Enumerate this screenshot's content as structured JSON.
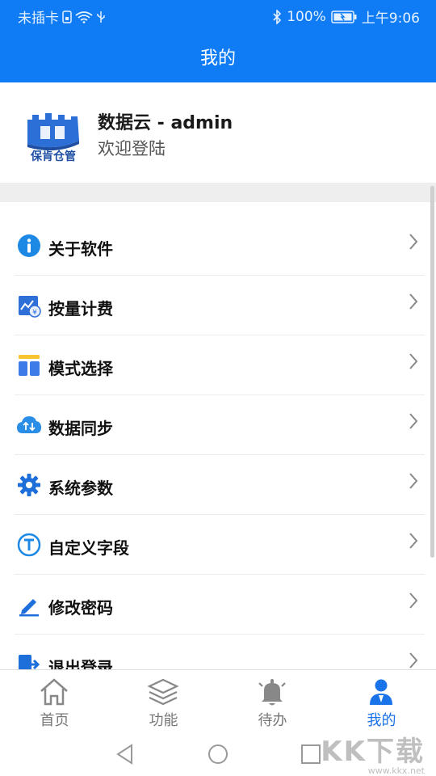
{
  "status_bar": {
    "carrier": "未插卡",
    "battery": "100%",
    "time": "上午9:06"
  },
  "header": {
    "title": "我的"
  },
  "profile": {
    "logo_text": "保肯仓管",
    "name": "数据云 - admin",
    "welcome": "欢迎登陆"
  },
  "menu": {
    "items": [
      {
        "label": "关于软件",
        "icon": "info-icon"
      },
      {
        "label": "按量计费",
        "icon": "billing-icon"
      },
      {
        "label": "模式选择",
        "icon": "mode-layout-icon"
      },
      {
        "label": "数据同步",
        "icon": "cloud-sync-icon"
      },
      {
        "label": "系统参数",
        "icon": "gear-icon"
      },
      {
        "label": "自定义字段",
        "icon": "text-t-icon"
      },
      {
        "label": "修改密码",
        "icon": "pencil-icon"
      },
      {
        "label": "退出登录",
        "icon": "logout-icon"
      }
    ]
  },
  "tabs": [
    {
      "label": "首页",
      "icon": "home-icon"
    },
    {
      "label": "功能",
      "icon": "layers-icon"
    },
    {
      "label": "待办",
      "icon": "bell-icon"
    },
    {
      "label": "我的",
      "icon": "person-icon",
      "active": true
    }
  ],
  "watermark": {
    "big": "KK下载",
    "small": "www.kkx.net"
  },
  "colors": {
    "primary": "#0f7cf6",
    "active_tab": "#1a73e8"
  }
}
